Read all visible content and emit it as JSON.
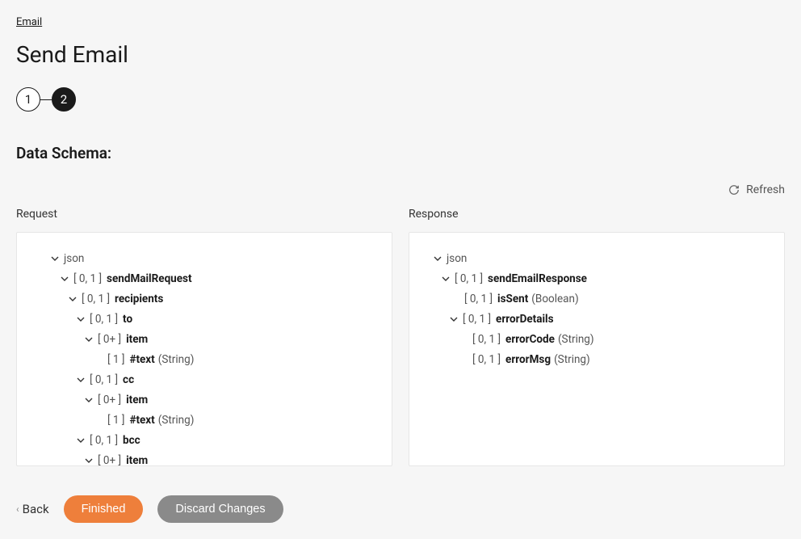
{
  "breadcrumb": {
    "email": "Email"
  },
  "title": "Send Email",
  "stepper": {
    "step1": "1",
    "step2": "2"
  },
  "section_title": "Data Schema:",
  "refresh_label": "Refresh",
  "columns": {
    "request": "Request",
    "response": "Response"
  },
  "req": {
    "root": "json",
    "sendMailRequest": {
      "card": "[ 0, 1 ]",
      "name": "sendMailRequest"
    },
    "recipients": {
      "card": "[ 0, 1 ]",
      "name": "recipients"
    },
    "to": {
      "card": "[ 0, 1 ]",
      "name": "to"
    },
    "to_item": {
      "card": "[ 0+ ]",
      "name": "item"
    },
    "to_text": {
      "card": "[ 1 ]",
      "name": "#text",
      "type": "(String)"
    },
    "cc": {
      "card": "[ 0, 1 ]",
      "name": "cc"
    },
    "cc_item": {
      "card": "[ 0+ ]",
      "name": "item"
    },
    "cc_text": {
      "card": "[ 1 ]",
      "name": "#text",
      "type": "(String)"
    },
    "bcc": {
      "card": "[ 0, 1 ]",
      "name": "bcc"
    },
    "bcc_item": {
      "card": "[ 0+ ]",
      "name": "item"
    }
  },
  "res": {
    "root": "json",
    "sendEmailResponse": {
      "card": "[ 0, 1 ]",
      "name": "sendEmailResponse"
    },
    "isSent": {
      "card": "[ 0, 1 ]",
      "name": "isSent",
      "type": "(Boolean)"
    },
    "errorDetails": {
      "card": "[ 0, 1 ]",
      "name": "errorDetails"
    },
    "errorCode": {
      "card": "[ 0, 1 ]",
      "name": "errorCode",
      "type": "(String)"
    },
    "errorMsg": {
      "card": "[ 0, 1 ]",
      "name": "errorMsg",
      "type": "(String)"
    }
  },
  "footer": {
    "back": "Back",
    "finished": "Finished",
    "discard": "Discard Changes"
  }
}
